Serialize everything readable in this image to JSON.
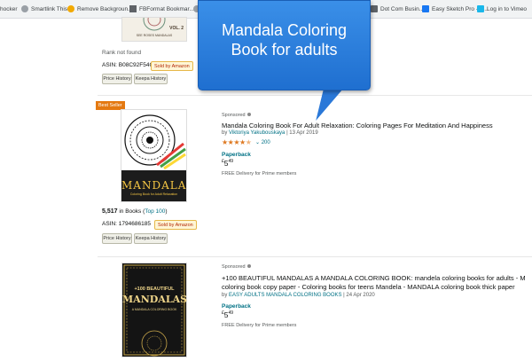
{
  "bookmarks": [
    {
      "label": "hocker",
      "icon": "globe-icon"
    },
    {
      "label": "Smartlink This",
      "icon": "globe-icon"
    },
    {
      "label": "Remove Backgroun...",
      "icon": "sun-icon"
    },
    {
      "label": "FBFormat Bookmar...",
      "icon": "document-icon"
    },
    {
      "label": "",
      "icon": "globe-icon"
    },
    {
      "label": "Dot Com Busin...",
      "icon": "folder-icon"
    },
    {
      "label": "Easy Sketch Pro - L...",
      "icon": "p-icon"
    },
    {
      "label": "Log in to Vimeo",
      "icon": "vimeo-icon"
    }
  ],
  "callout": {
    "text_line1": "Mandala Coloring",
    "text_line2": "Book for adults"
  },
  "top_listing": {
    "rank_text": "Rank not found",
    "asin_label": "ASIN:",
    "asin": "B08C92F54Q",
    "sold_by": "Sold by Amazon",
    "price_history": "Price History",
    "keepa_history": "Keepa History"
  },
  "listing1": {
    "badge": "Best Seller",
    "sponsored": "Sponsored",
    "title": "Mandala Coloring Book For Adult Relaxation: Coloring Pages For Meditation And Happiness",
    "by": "by",
    "author": "Viktoriya Yakubouskaya",
    "date": "13 Apr 2019",
    "rating_count": "200",
    "format": "Paperback",
    "price_symbol": "£",
    "price_whole": "5",
    "price_fraction": "49",
    "delivery": "FREE Delivery for Prime members",
    "rank_number": "5,517",
    "rank_text": "in Books (",
    "rank_link": "Top 100",
    "rank_close": ")",
    "asin_label": "ASIN:",
    "asin": "1794686185",
    "sold_by": "Sold by Amazon",
    "price_history": "Price History",
    "keepa_history": "Keepa History",
    "cover_title": "MANDALA",
    "cover_subtitle": "Coloring Book for Adult Relaxation"
  },
  "listing2": {
    "sponsored": "Sponsored",
    "title_line1": "+100 BEAUTIFUL MANDALAS A MANDALA COLORING BOOK: mandela coloring books for adults - M",
    "title_line2": "coloring book copy paper - Coloring books for teens Mandela - MANDALA coloring book thick paper",
    "by": "by",
    "author": "EASY ADULTS MANDALA COLORING BOOKS",
    "date": "24 Apr 2020",
    "format": "Paperback",
    "price_symbol": "£",
    "price_whole": "5",
    "price_fraction": "49",
    "delivery": "FREE Delivery for Prime members",
    "cover_title_1": "+100 BEAUTIFUL",
    "cover_title_2": "MANDALAS",
    "cover_subtitle": "A MANDALA COLORING BOOK"
  },
  "top_cover_text": {
    "vol": "VOL. 2",
    "caption": "SEE ROSES MANDALAS"
  }
}
